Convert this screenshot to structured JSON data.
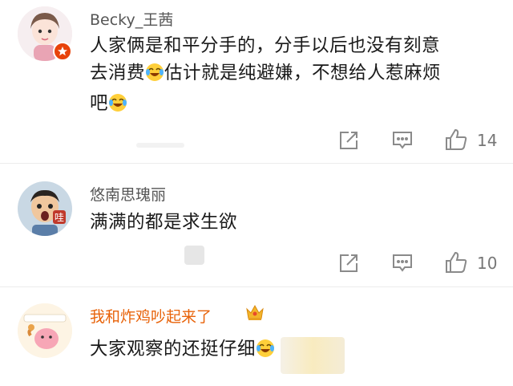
{
  "comments": [
    {
      "username": "Becky_王茜",
      "text_lines": [
        "人家俩是和平分手的，分手以后也没有刻意",
        "去消费",
        "估计就是纯避嫌，不想给人惹麻烦",
        "吧"
      ],
      "likes": "14"
    },
    {
      "username": "悠南思瑰丽",
      "text_lines": [
        "满满的都是求生欲"
      ],
      "likes": "10",
      "avatar_label": "哇"
    },
    {
      "username": "我和炸鸡吵起来了",
      "text_lines": [
        "大家观察的还挺仔细"
      ]
    }
  ],
  "icons": {
    "share": "share-icon",
    "comment": "comment-icon",
    "like": "thumbs-up-icon",
    "laugh_cry": "laugh-cry-emoji",
    "crown": "crown-icon",
    "vip": "vip-badge-icon"
  },
  "colors": {
    "username_default": "#555555",
    "username_vip": "#e8630a",
    "icon_gray": "#8a8a8a"
  }
}
